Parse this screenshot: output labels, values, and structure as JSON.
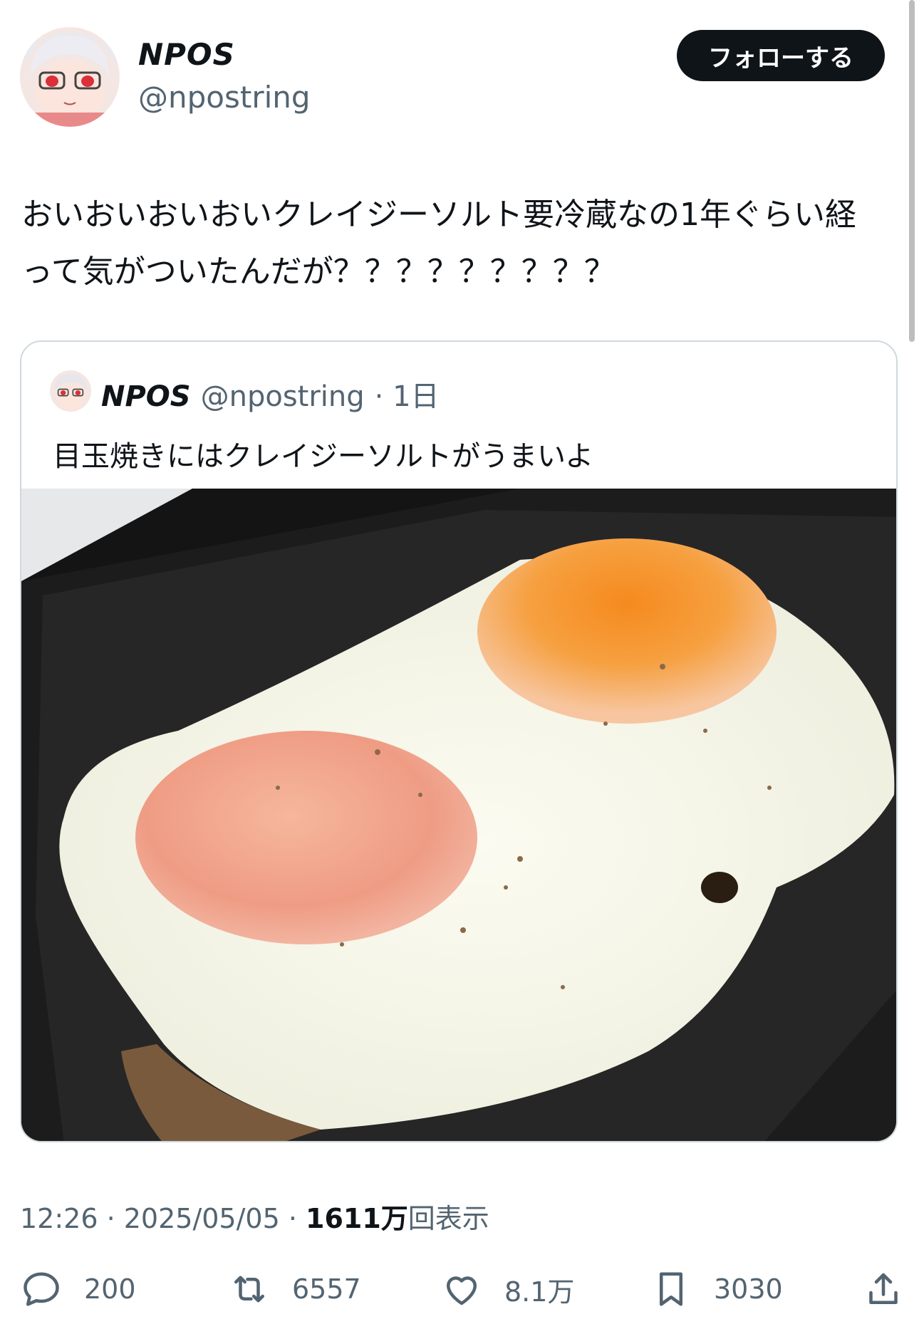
{
  "author": {
    "display_name": "NPOS",
    "handle": "@npostring",
    "follow_label": "フォローする"
  },
  "post": {
    "text": "おいおいおいおいクレイジーソルト要冷蔵なの1年ぐらい経って気がついたんだが？？？？？？？？？",
    "time": "12:26 · 2025/05/05 · ",
    "views_number": "1611万",
    "views_suffix": "回表示"
  },
  "quoted": {
    "display_name": "NPOS",
    "handle": "@npostring",
    "age": "· 1日",
    "text": "目玉焼きにはクレイジーソルトがうまいよ"
  },
  "actions": {
    "replies": "200",
    "reposts": "6557",
    "likes": "8.1万",
    "bookmarks": "3030"
  },
  "icons": [
    "reply-icon",
    "repost-icon",
    "like-icon",
    "bookmark-icon",
    "share-icon"
  ]
}
